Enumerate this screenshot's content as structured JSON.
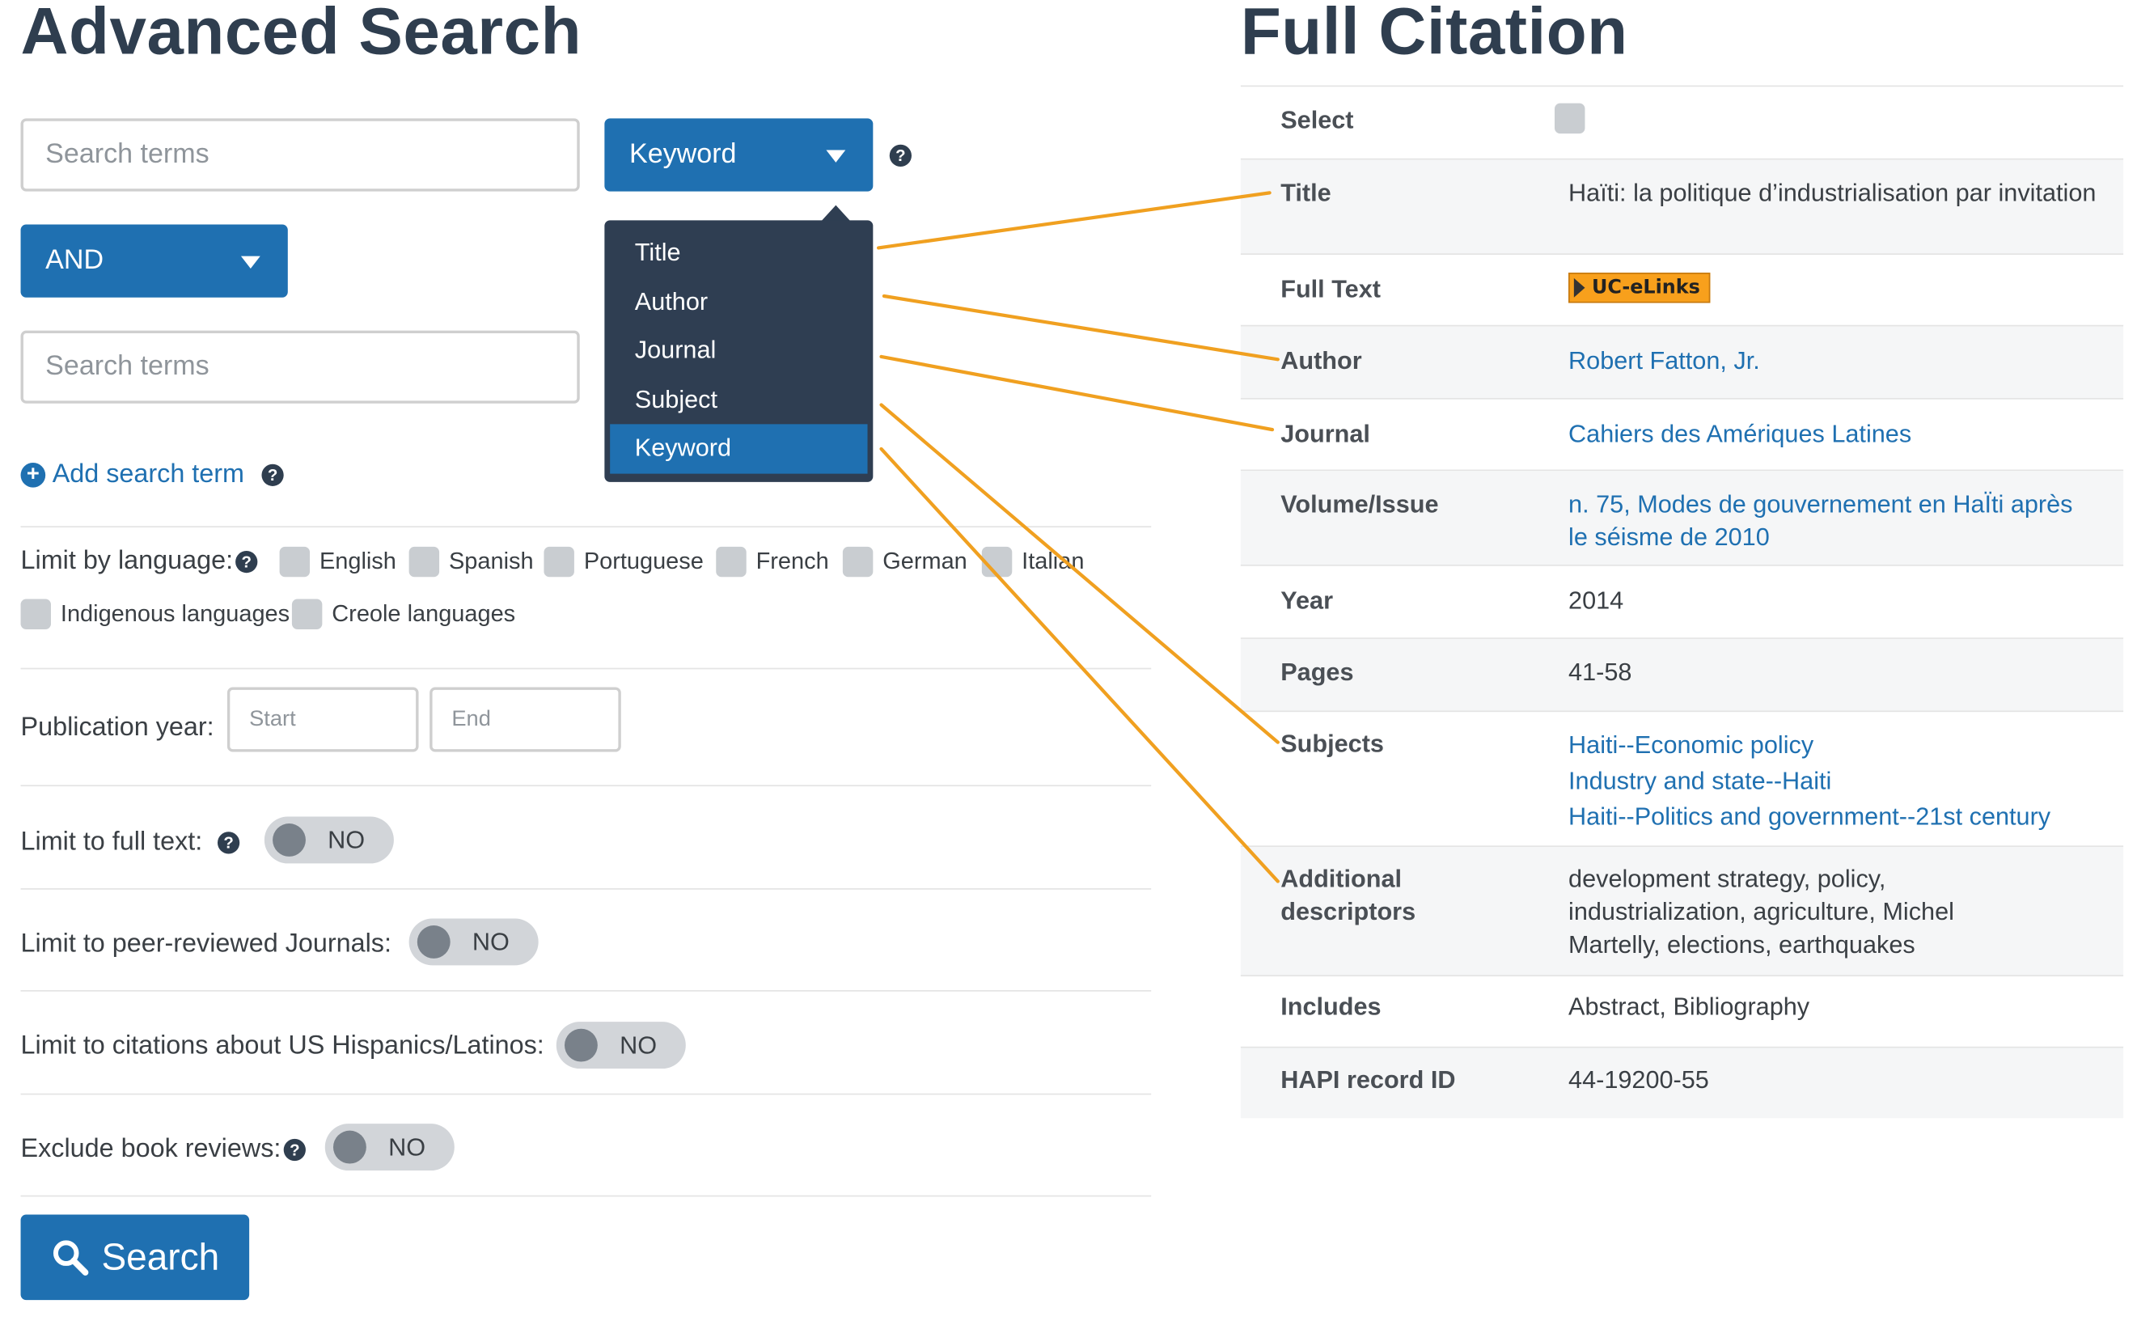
{
  "left_panel": {
    "heading": "Advanced Search",
    "search_terms_placeholder": "Search terms",
    "field_select_value": "Keyword",
    "operator_select_value": "AND",
    "field_options": [
      "Title",
      "Author",
      "Journal",
      "Subject",
      "Keyword"
    ],
    "field_options_selected": "Keyword",
    "help_glyph": "?",
    "add_search_term_label": "Add search term",
    "add_icon_glyph": "+",
    "language_label": "Limit by language:",
    "languages": [
      "English",
      "Spanish",
      "Portuguese",
      "French",
      "German",
      "Italian",
      "Indigenous languages",
      "Creole languages"
    ],
    "pub_year_label": "Publication year:",
    "pub_year_start_placeholder": "Start",
    "pub_year_end_placeholder": "End",
    "full_text_label": "Limit to full text:",
    "full_text_value": "NO",
    "peer_reviewed_label": "Limit to peer-reviewed Journals:",
    "peer_reviewed_value": "NO",
    "hispanics_label": "Limit to citations about US Hispanics/Latinos:",
    "hispanics_value": "NO",
    "book_reviews_label": "Exclude book reviews:",
    "book_reviews_value": "NO",
    "search_button_label": "Search"
  },
  "right_panel": {
    "heading": "Full Citation",
    "rows": {
      "select_key": "Select",
      "title_key": "Title",
      "title_value": "Haïti: la politique d’industrialisation par invitation",
      "fulltext_key": "Full Text",
      "fulltext_badge": "UC-eLinks",
      "author_key": "Author",
      "author_value": "Robert Fatton, Jr.",
      "journal_key": "Journal",
      "journal_value": "Cahiers des Amériques Latines",
      "volume_key": "Volume/Issue",
      "volume_value": "n. 75, Modes de gouvernement en HaÏti après le séisme de 2010",
      "year_key": "Year",
      "year_value": "2014",
      "pages_key": "Pages",
      "pages_value": "41-58",
      "subjects_key": "Subjects",
      "subjects_values": [
        "Haiti--Economic policy",
        "Industry and state--Haiti",
        "Haiti--Politics and government--21st century"
      ],
      "descriptors_key": "Additional descriptors",
      "descriptors_value": "development strategy, policy, industrialization, agriculture, Michel Martelly, elections, earthquakes",
      "includes_key": "Includes",
      "includes_value": "Abstract, Bibliography",
      "hapi_key": "HAPI record ID",
      "hapi_value": "44-19200-55"
    }
  },
  "colors": {
    "primary_blue": "#1f70b1",
    "dropdown_bg": "#2f3e52",
    "heading_color": "#2f3e4f",
    "connector_orange": "#f0a020",
    "checkbox_gray": "#c9cdd1"
  }
}
